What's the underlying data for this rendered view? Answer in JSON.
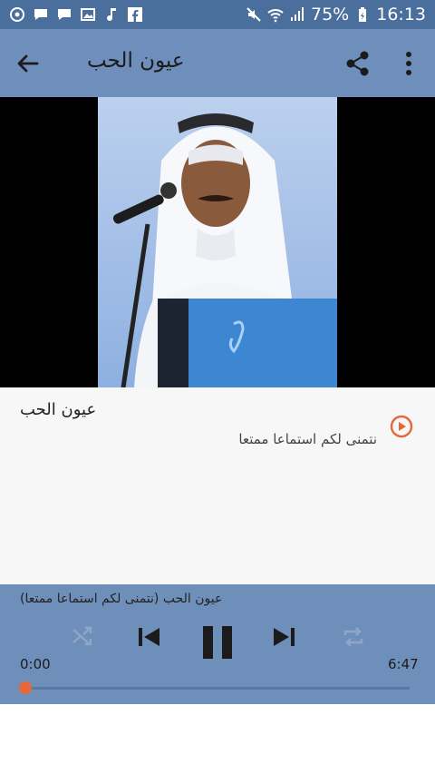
{
  "status": {
    "battery": "75%",
    "time": "16:13",
    "icons": [
      "vine-icon",
      "chat-icon",
      "message-icon",
      "image-icon",
      "music-note-icon",
      "facebook-icon",
      "mute-icon",
      "wifi-icon",
      "signal-icon",
      "battery-icon"
    ]
  },
  "header": {
    "title": "عيون الحب"
  },
  "track": {
    "title": "عيون الحب",
    "subtitle": "نتمنى لكم استماعا ممتعا"
  },
  "player": {
    "now_playing": "(نتمنى لكم استماعا ممتعا) عيون الحب",
    "time_start": "0:00",
    "time_end": "6:47",
    "progress": 0
  },
  "colors": {
    "status_bar": "#4a6f9c",
    "app_bar": "#6e8fbb",
    "accent": "#e8673a"
  }
}
